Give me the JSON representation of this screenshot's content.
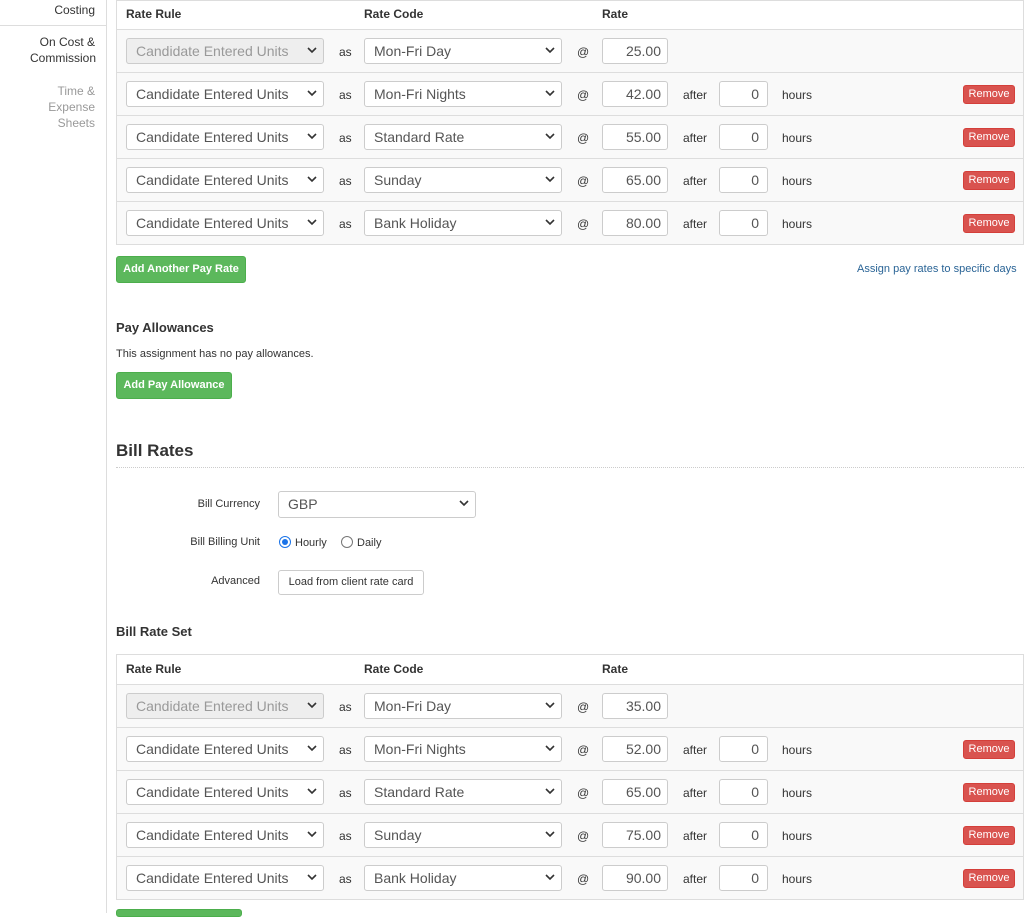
{
  "sidebar": {
    "items": [
      {
        "label": "Costing"
      },
      {
        "label": "On Cost & Commission"
      },
      {
        "label": "Time & Expense Sheets"
      }
    ]
  },
  "pay_rate_set": {
    "columns": {
      "rate_rule": "Rate Rule",
      "rate_code": "Rate Code",
      "rate": "Rate"
    },
    "rows": [
      {
        "rule": "Candidate Entered Units",
        "as": "as",
        "code": "Mon-Fri Day",
        "at": "@",
        "rate": "25.00",
        "first": true
      },
      {
        "rule": "Candidate Entered Units",
        "as": "as",
        "code": "Mon-Fri Nights",
        "at": "@",
        "rate": "42.00",
        "after": "after",
        "hours_value": "0",
        "hours": "hours",
        "remove": "Remove"
      },
      {
        "rule": "Candidate Entered Units",
        "as": "as",
        "code": "Standard Rate",
        "at": "@",
        "rate": "55.00",
        "after": "after",
        "hours_value": "0",
        "hours": "hours",
        "remove": "Remove"
      },
      {
        "rule": "Candidate Entered Units",
        "as": "as",
        "code": "Sunday",
        "at": "@",
        "rate": "65.00",
        "after": "after",
        "hours_value": "0",
        "hours": "hours",
        "remove": "Remove"
      },
      {
        "rule": "Candidate Entered Units",
        "as": "as",
        "code": "Bank Holiday",
        "at": "@",
        "rate": "80.00",
        "after": "after",
        "hours_value": "0",
        "hours": "hours",
        "remove": "Remove"
      }
    ],
    "add_button": "Add Another Pay Rate",
    "assign_link": "Assign pay rates to specific days"
  },
  "pay_allowances": {
    "title": "Pay Allowances",
    "empty_text": "This assignment has no pay allowances.",
    "add_button": "Add Pay Allowance"
  },
  "bill_rates": {
    "title": "Bill Rates",
    "currency_label": "Bill Currency",
    "currency_value": "GBP",
    "billing_unit_label": "Bill Billing Unit",
    "billing_unit_options": [
      "Hourly",
      "Daily"
    ],
    "billing_unit_selected": "Hourly",
    "advanced_label": "Advanced",
    "load_button": "Load from client rate card"
  },
  "bill_rate_set": {
    "title": "Bill Rate Set",
    "columns": {
      "rate_rule": "Rate Rule",
      "rate_code": "Rate Code",
      "rate": "Rate"
    },
    "rows": [
      {
        "rule": "Candidate Entered Units",
        "as": "as",
        "code": "Mon-Fri Day",
        "at": "@",
        "rate": "35.00",
        "first": true
      },
      {
        "rule": "Candidate Entered Units",
        "as": "as",
        "code": "Mon-Fri Nights",
        "at": "@",
        "rate": "52.00",
        "after": "after",
        "hours_value": "0",
        "hours": "hours",
        "remove": "Remove"
      },
      {
        "rule": "Candidate Entered Units",
        "as": "as",
        "code": "Standard Rate",
        "at": "@",
        "rate": "65.00",
        "after": "after",
        "hours_value": "0",
        "hours": "hours",
        "remove": "Remove"
      },
      {
        "rule": "Candidate Entered Units",
        "as": "as",
        "code": "Sunday",
        "at": "@",
        "rate": "75.00",
        "after": "after",
        "hours_value": "0",
        "hours": "hours",
        "remove": "Remove"
      },
      {
        "rule": "Candidate Entered Units",
        "as": "as",
        "code": "Bank Holiday",
        "at": "@",
        "rate": "90.00",
        "after": "after",
        "hours_value": "0",
        "hours": "hours",
        "remove": "Remove"
      }
    ]
  },
  "colors": {
    "accent_green": "#5cb85c",
    "danger_red": "#d9534f",
    "link_blue": "#2a6496"
  }
}
